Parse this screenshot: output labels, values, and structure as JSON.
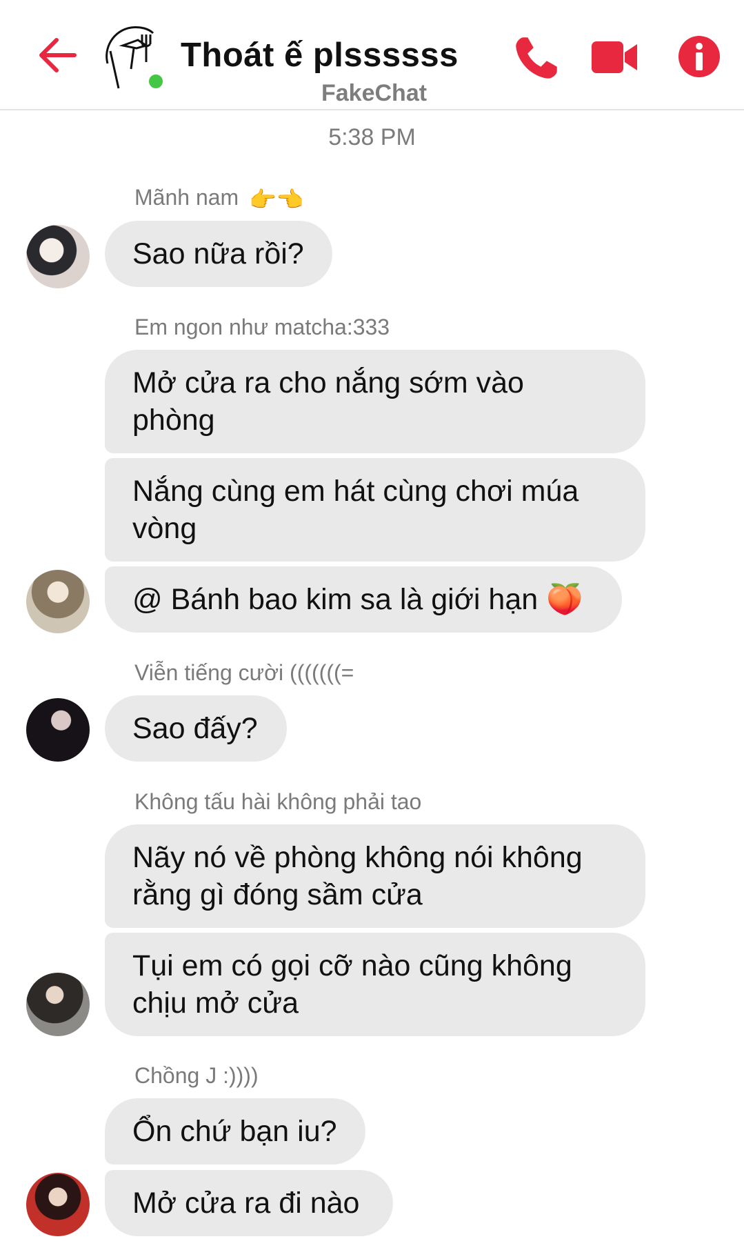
{
  "header": {
    "title": "Thoát ế plssssss",
    "subtitle": "FakeChat",
    "accent_color": "#e8283e",
    "online_color": "#44c744",
    "icons": [
      "back-arrow-icon",
      "group-avatar-icon",
      "phone-icon",
      "video-camera-icon",
      "info-icon"
    ]
  },
  "timestamp": "5:38 PM",
  "groups": [
    {
      "sender": "Mãnh nam",
      "sender_emoji": "👉👈",
      "messages": [
        "Sao nữa rồi?"
      ]
    },
    {
      "sender": "Em ngon như matcha:333",
      "messages": [
        "Mở cửa ra cho nắng sớm vào\nphòng",
        "Nắng cùng em hát cùng chơi múa\nvòng",
        "@ Bánh bao kim sa là giới hạn"
      ],
      "last_emoji": "🍑"
    },
    {
      "sender": "Viễn tiếng cười (((((((=",
      "messages": [
        "Sao đấy?"
      ]
    },
    {
      "sender": "Không tấu hài không phải tao",
      "messages": [
        "Nãy nó về phòng không nói không\nrằng gì đóng sầm cửa",
        "Tụi em có gọi cỡ nào cũng không\nchịu mở cửa"
      ]
    },
    {
      "sender": "Chồng J :))))",
      "messages": [
        "Ổn chứ bạn iu?",
        "Mở cửa ra đi nào"
      ]
    }
  ]
}
